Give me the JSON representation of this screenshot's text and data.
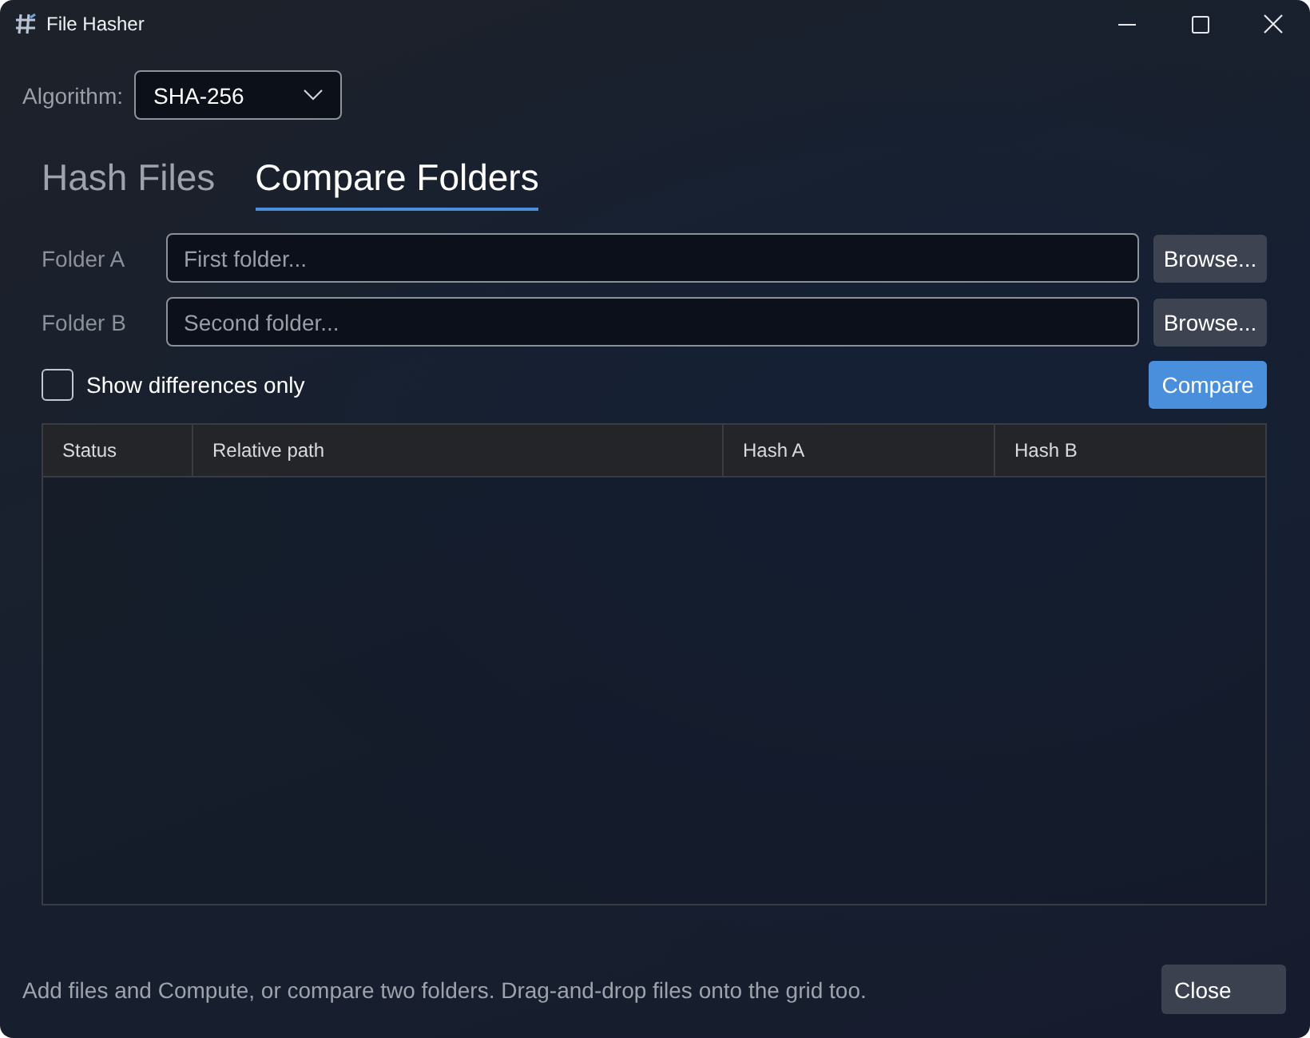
{
  "window": {
    "title": "File Hasher"
  },
  "algorithm": {
    "label": "Algorithm:",
    "value": "SHA-256"
  },
  "tabs": [
    {
      "label": "Hash Files",
      "selected": false
    },
    {
      "label": "Compare Folders",
      "selected": true
    }
  ],
  "folders": [
    {
      "label": "Folder A",
      "placeholder": "First folder...",
      "button": "Browse..."
    },
    {
      "label": "Folder B",
      "placeholder": "Second folder...",
      "button": "Browse..."
    }
  ],
  "show_differences": {
    "label": "Show differences only",
    "checked": false
  },
  "compare_button": "Compare",
  "table": {
    "columns": [
      "Status",
      "Relative path",
      "Hash A",
      "Hash B"
    ]
  },
  "status_bar": {
    "text": "Add files and Compute, or compare two folders. Drag-and-drop files onto the grid too.",
    "close_button": "Close"
  }
}
